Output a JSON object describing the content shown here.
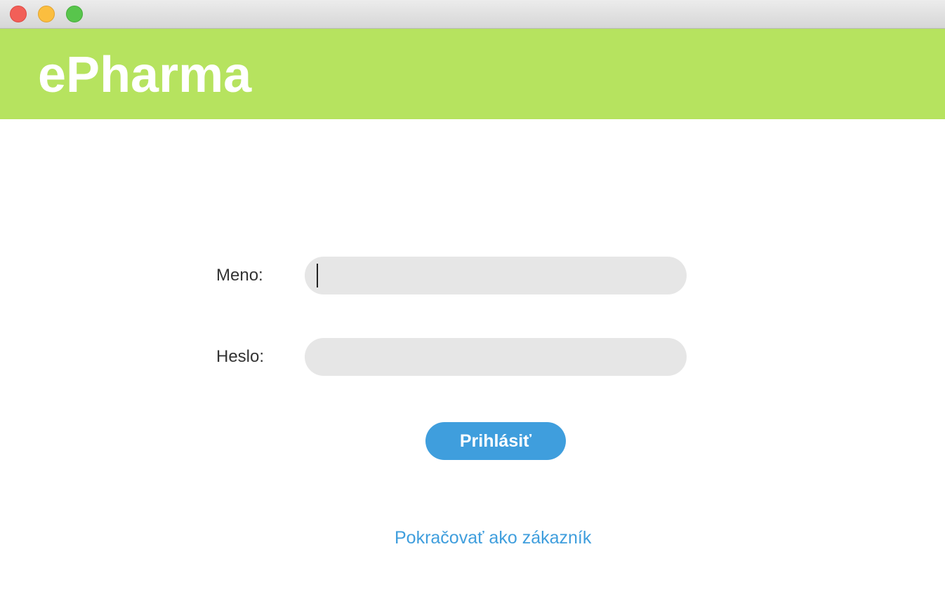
{
  "window": {
    "controls": {
      "close": "close-icon",
      "minimize": "minimize-icon",
      "maximize": "maximize-icon"
    }
  },
  "header": {
    "brand": "ePharma",
    "background_color": "#b6e35f"
  },
  "form": {
    "username_label": "Meno:",
    "username_value": "",
    "password_label": "Heslo:",
    "password_value": "",
    "login_button": "Prihlásiť",
    "accent_color": "#3f9edd"
  },
  "guest": {
    "link_text": "Pokračovať ako zákazník"
  }
}
